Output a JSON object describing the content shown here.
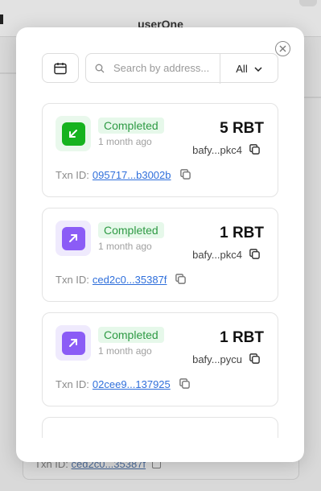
{
  "background": {
    "title": "userOne",
    "txn_label": "Txn ID:",
    "txn_id": "ced2c0...35387f"
  },
  "toolbar": {
    "search_placeholder": "Search by address...",
    "filter_value": "All"
  },
  "transactions": [
    {
      "direction": "incoming",
      "status": "Completed",
      "time_ago": "1 month ago",
      "amount": "5 RBT",
      "address": "bafy...pkc4",
      "txn_label": "Txn ID:",
      "txn_id": "095717...b3002b",
      "icon": "arrow-down-left-icon",
      "icon_color": "#22b33a",
      "icon_bg": "#e9f8ec"
    },
    {
      "direction": "outgoing",
      "status": "Completed",
      "time_ago": "1 month ago",
      "amount": "1 RBT",
      "address": "bafy...pkc4",
      "txn_label": "Txn ID:",
      "txn_id": "ced2c0...35387f",
      "icon": "arrow-up-right-icon",
      "icon_color": "#8b5cf6",
      "icon_bg": "#efeafd"
    },
    {
      "direction": "outgoing",
      "status": "Completed",
      "time_ago": "1 month ago",
      "amount": "1 RBT",
      "address": "bafy...pycu",
      "txn_label": "Txn ID:",
      "txn_id": "02cee9...137925",
      "icon": "arrow-up-right-icon",
      "icon_color": "#8b5cf6",
      "icon_bg": "#efeafd"
    }
  ],
  "colors": {
    "status_green": "#2e9a44",
    "status_bg": "#e6f8ea",
    "link_blue": "#2f6fdb"
  }
}
